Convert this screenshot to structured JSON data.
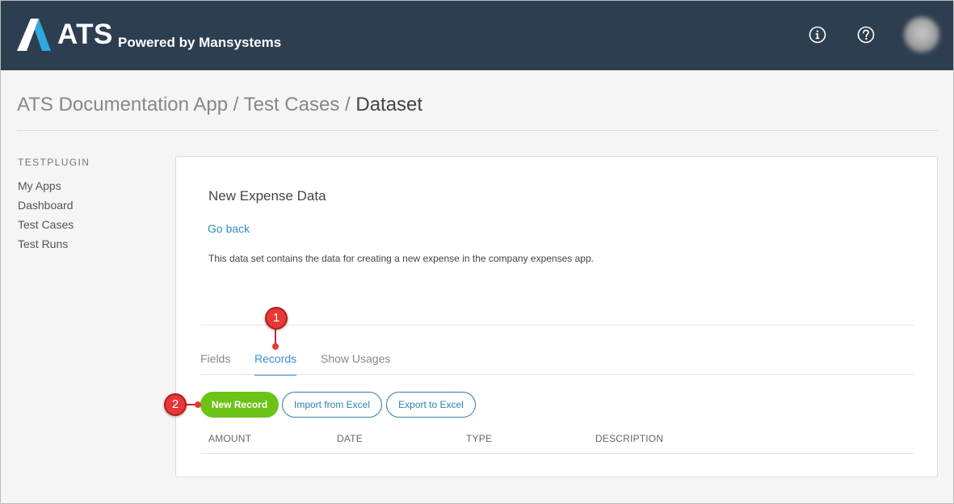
{
  "header": {
    "logo_text": "ATS",
    "tagline": "Powered by Mansystems",
    "icons": [
      "info-icon",
      "help-icon"
    ],
    "brand_color": "#2e3e51",
    "logo_accent": "#2fa8e0"
  },
  "breadcrumb": {
    "items": [
      "ATS Documentation App",
      "Test Cases"
    ],
    "separator": "/",
    "current": "Dataset"
  },
  "sidebar": {
    "title": "TESTPLUGIN",
    "items": [
      {
        "label": "My Apps"
      },
      {
        "label": "Dashboard"
      },
      {
        "label": "Test Cases"
      },
      {
        "label": "Test Runs"
      }
    ]
  },
  "dataset": {
    "title": "New Expense Data",
    "go_back": "Go back",
    "description": "This data set contains the data for creating a new expense in the company expenses app."
  },
  "tabs": [
    {
      "label": "Fields",
      "active": false
    },
    {
      "label": "Records",
      "active": true
    },
    {
      "label": "Show Usages",
      "active": false
    }
  ],
  "actions": {
    "new_record": "New Record",
    "import_excel": "Import from Excel",
    "export_excel": "Export to Excel"
  },
  "table": {
    "columns": [
      "AMOUNT",
      "DATE",
      "TYPE",
      "DESCRIPTION"
    ]
  },
  "annotations": [
    {
      "number": "1",
      "target": "Records tab"
    },
    {
      "number": "2",
      "target": "New Record button"
    }
  ],
  "colors": {
    "primary_button": "#6cc217",
    "link": "#2d90c7",
    "active_tab": "#3a8fd6",
    "marker": "#e53935"
  }
}
